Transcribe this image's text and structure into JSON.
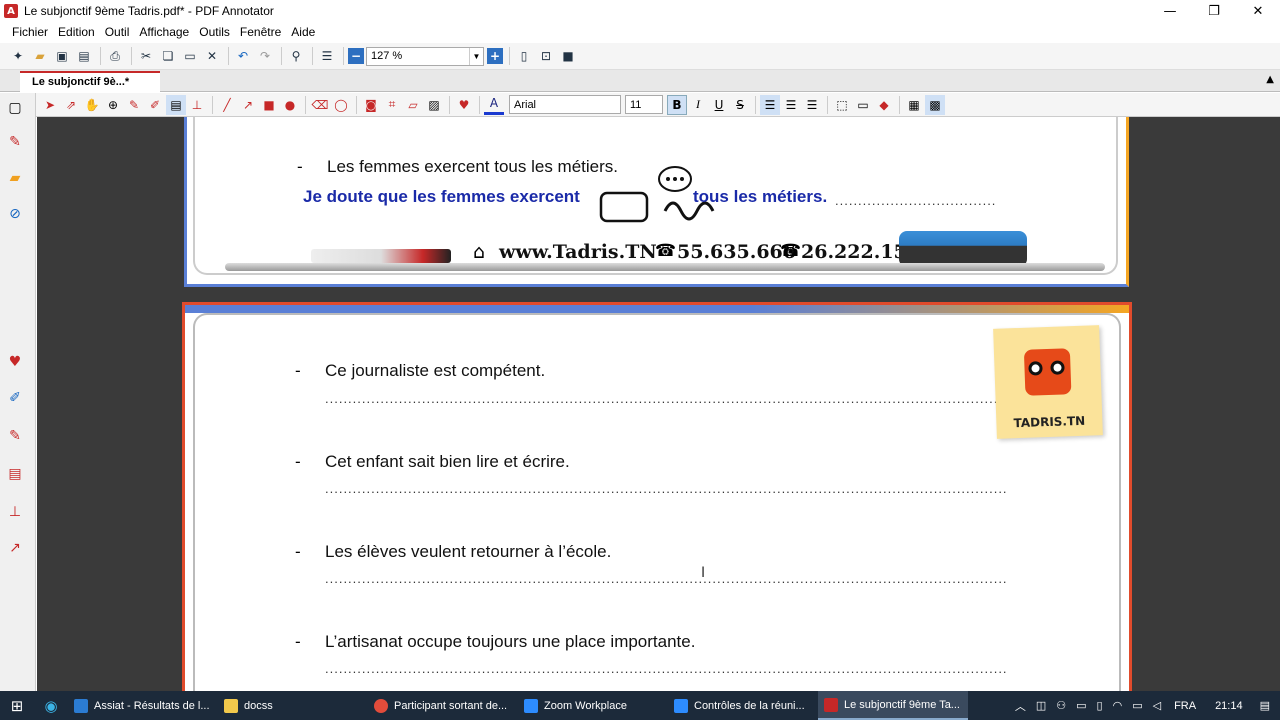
{
  "window": {
    "title": "Le subjonctif 9ème Tadris.pdf* - PDF Annotator",
    "minimize": "—",
    "restore": "❐",
    "close": "✕"
  },
  "menu": [
    "Fichier",
    "Edition",
    "Outil",
    "Affichage",
    "Outils",
    "Fenêtre",
    "Aide"
  ],
  "toolbar": {
    "zoom_value": "127 %"
  },
  "tab": {
    "label": "Le subjonctif 9è...*"
  },
  "format": {
    "font": "Arial",
    "size": "11",
    "bold": "B",
    "italic": "I",
    "underline": "U",
    "strike": "S"
  },
  "page1": {
    "sentence": "Les femmes exercent tous les métiers.",
    "answer_part1": "Je doute que les femmes exercent",
    "answer_part2": "tous les métiers.",
    "contact": {
      "website": "www.Tadris.TN",
      "phone1": "55.635.666",
      "phone2": "26.222.159"
    }
  },
  "page2": {
    "sentences": [
      "Ce journaliste est compétent.",
      "Cet enfant sait bien lire et écrire.",
      "Les élèves veulent retourner à l’école.",
      "L’artisanat occupe toujours une place importante."
    ],
    "sticker_label": "TADRIS.TN"
  },
  "taskbar": {
    "items": [
      {
        "label": "Assiat - Résultats de l...",
        "color": "#2b7cd3"
      },
      {
        "label": "docss",
        "color": "#f2c94c"
      },
      {
        "label": "Participant sortant de...",
        "color": "#e24c3b"
      },
      {
        "label": "Zoom Workplace",
        "color": "#2d8cff"
      },
      {
        "label": "Contrôles de la réuni...",
        "color": "#2d8cff"
      },
      {
        "label": "Le subjonctif 9ème Ta...",
        "color": "#c62828"
      }
    ],
    "language": "FRA",
    "time": "21:14"
  }
}
